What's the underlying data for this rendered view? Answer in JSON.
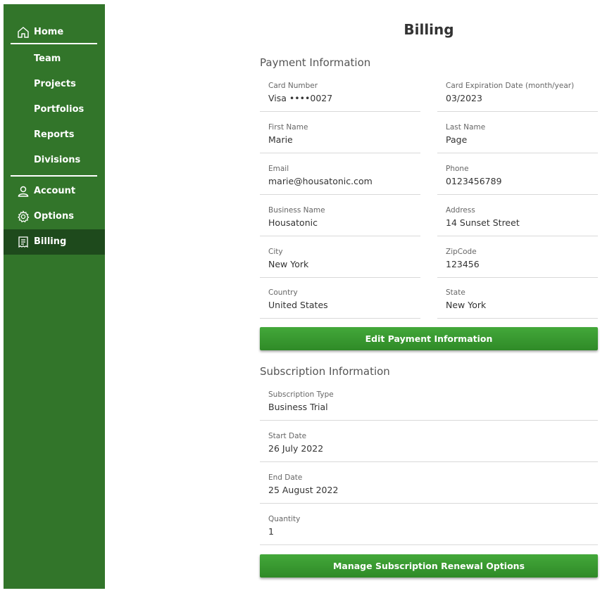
{
  "sidebar": {
    "home": "Home",
    "team": "Team",
    "projects": "Projects",
    "portfolios": "Portfolios",
    "reports": "Reports",
    "divisions": "Divisions",
    "account": "Account",
    "options": "Options",
    "billing": "Billing",
    "colors": {
      "background": "#32752a",
      "active": "#1e4a1c"
    },
    "icons": {
      "home": "home-icon",
      "account": "user-icon",
      "options": "gear-icon",
      "billing": "receipt-icon"
    }
  },
  "page": {
    "title": "Billing"
  },
  "payment": {
    "section_title": "Payment Information",
    "card_number": {
      "label": "Card Number",
      "value": "Visa ••••0027"
    },
    "card_expiration": {
      "label": "Card Expiration Date (month/year)",
      "value": "03/2023"
    },
    "first_name": {
      "label": "First Name",
      "value": "Marie"
    },
    "last_name": {
      "label": "Last Name",
      "value": "Page"
    },
    "email": {
      "label": "Email",
      "value": "marie@housatonic.com"
    },
    "phone": {
      "label": "Phone",
      "value": "0123456789"
    },
    "business_name": {
      "label": "Business Name",
      "value": "Housatonic"
    },
    "address": {
      "label": "Address",
      "value": "14 Sunset Street"
    },
    "city": {
      "label": "City",
      "value": "New York"
    },
    "zipcode": {
      "label": "ZipCode",
      "value": "123456"
    },
    "country": {
      "label": "Country",
      "value": "United States"
    },
    "state": {
      "label": "State",
      "value": "New York"
    },
    "edit_button": "Edit Payment Information"
  },
  "subscription": {
    "section_title": "Subscription Information",
    "type": {
      "label": "Subscription Type",
      "value": "Business Trial"
    },
    "start_date": {
      "label": "Start Date",
      "value": "26 July 2022"
    },
    "end_date": {
      "label": "End Date",
      "value": "25 August 2022"
    },
    "quantity": {
      "label": "Quantity",
      "value": "1"
    },
    "manage_button": "Manage Subscription Renewal Options"
  },
  "colors": {
    "button": "#3a9a31",
    "accent_text": "#333333"
  }
}
